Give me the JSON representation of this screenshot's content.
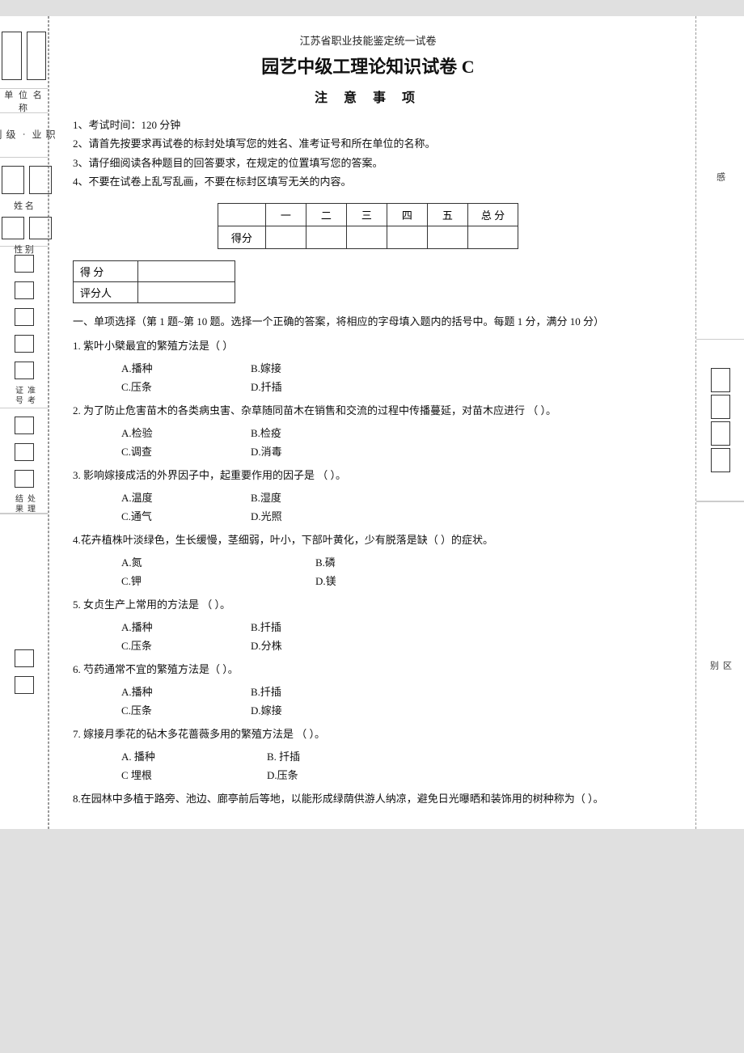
{
  "header": {
    "subtitle": "江苏省职业技能鉴定统一试卷",
    "title": "园艺中级工理论知识试卷 C",
    "notice_title": "注    意    事    项",
    "notice_items": [
      "1、考试时间：120 分钟",
      "2、请首先按要求再试卷的标封处填写您的姓名、准考证号和所在单位的名称。",
      "3、请仔细阅读各种题目的回答要求，在规定的位置填写您的答案。",
      "4、不要在试卷上乱写乱画，不要在标封区填写无关的内容。"
    ]
  },
  "score_table": {
    "headers": [
      "",
      "一",
      "二",
      "三",
      "四",
      "五",
      "总 分"
    ],
    "row_label": "得分"
  },
  "small_score": {
    "rows": [
      "得 分",
      "评分人"
    ]
  },
  "section1": {
    "title": "一、单项选择（第 1 题~第 10 题。选择一个正确的答案，将相应的字母填入题内的括号中。每题 1 分，满分 10 分）",
    "questions": [
      {
        "num": "1.",
        "text": "紫叶小檗最宜的繁殖方法是（    ）",
        "options": [
          [
            "A.播种",
            "B.嫁接"
          ],
          [
            "C.压条",
            "D.扦插"
          ]
        ]
      },
      {
        "num": "2.",
        "text": "为了防止危害苗木的各类病虫害、杂草随同苗木在销售和交流的过程中传播蔓延，对苗木应进行  （    ）。",
        "options": [
          [
            "A.检验",
            "B.检疫"
          ],
          [
            "C.调查",
            "D.消毒"
          ]
        ]
      },
      {
        "num": "3.",
        "text": "影响嫁接成活的外界因子中，起重要作用的因子是  （    ）。",
        "options": [
          [
            "A.温度",
            "B.湿度"
          ],
          [
            "C.通气",
            "D.光照"
          ]
        ]
      },
      {
        "num": "4.",
        "text": "花卉植株叶淡绿色，生长缓慢，茎细弱，叶小，下部叶黄化，少有脱落是缺（    ）的症状。",
        "options": [
          [
            "A.氮",
            "B.磷"
          ],
          [
            "C.钾",
            "D.镁"
          ]
        ]
      },
      {
        "num": "5.",
        "text": "女贞生产上常用的方法是  （    ）。",
        "options": [
          [
            "A.播种",
            "B.扦插"
          ],
          [
            "C.压条",
            "D.分株"
          ]
        ]
      },
      {
        "num": "6.",
        "text": "芍药通常不宜的繁殖方法是（    ）。",
        "options": [
          [
            "A.播种",
            "B.扦插"
          ],
          [
            "C.压条",
            "D.嫁接"
          ]
        ]
      },
      {
        "num": "7.",
        "text": "嫁接月季花的砧木多花蔷薇多用的繁殖方法是  （    ）。",
        "options": [
          [
            "A. 播种",
            "B. 扦插"
          ],
          [
            "C 埋根",
            "D.压条"
          ]
        ]
      },
      {
        "num": "8.",
        "text": "在园林中多植于路旁、池边、廊亭前后等地，以能形成绿荫供游人纳凉，避免日光曝晒和装饰用的树种称为（    ）。"
      }
    ]
  },
  "sidebar_labels": {
    "unit": "单 位 名 称",
    "level": "职 业 · 级 别",
    "name": "姓 名",
    "gender": "性 别",
    "score": "准 考 证 号",
    "handle": "处 理 结 果"
  },
  "right_sidebar": {
    "section1": "感",
    "section2": "区\n别"
  }
}
